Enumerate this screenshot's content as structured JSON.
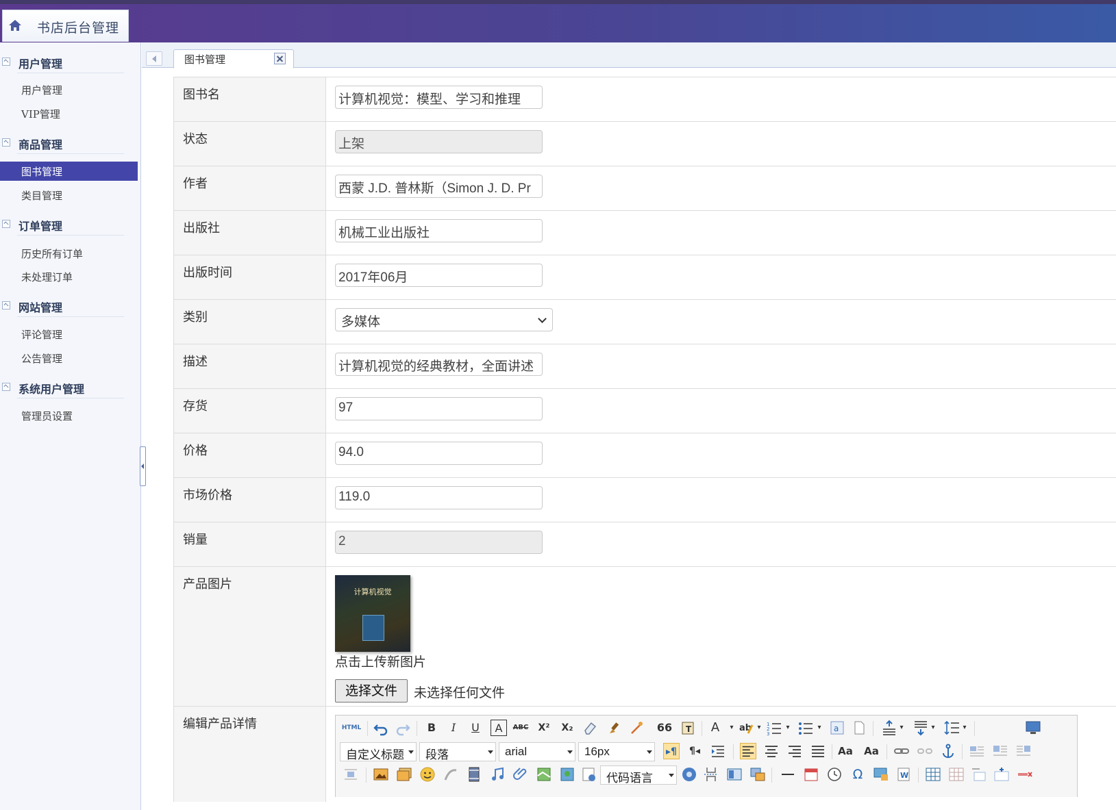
{
  "app": {
    "title": "书店后台管理"
  },
  "sidebar": {
    "groups": [
      {
        "label": "用户管理",
        "items": [
          "用户管理",
          "VIP管理"
        ]
      },
      {
        "label": "商品管理",
        "items": [
          "图书管理",
          "类目管理"
        ]
      },
      {
        "label": "订单管理",
        "items": [
          "历史所有订单",
          "未处理订单"
        ]
      },
      {
        "label": "网站管理",
        "items": [
          "评论管理",
          "公告管理"
        ]
      },
      {
        "label": "系统用户管理",
        "items": [
          "管理员设置"
        ]
      }
    ],
    "active_item": "图书管理"
  },
  "tabs": [
    {
      "label": "图书管理",
      "active": true
    }
  ],
  "form": {
    "name": {
      "label": "图书名",
      "value": "计算机视觉：模型、学习和推理"
    },
    "status": {
      "label": "状态",
      "value": "上架"
    },
    "author": {
      "label": "作者",
      "value": "西蒙 J.D. 普林斯（Simon J. D. Pr"
    },
    "publisher": {
      "label": "出版社",
      "value": "机械工业出版社"
    },
    "pub_date": {
      "label": "出版时间",
      "value": "2017年06月"
    },
    "category": {
      "label": "类别",
      "value": "多媒体"
    },
    "description": {
      "label": "描述",
      "value": "计算机视觉的经典教材，全面讲述"
    },
    "stock": {
      "label": "存货",
      "value": "97"
    },
    "price": {
      "label": "价格",
      "value": "94.0"
    },
    "market_price": {
      "label": "市场价格",
      "value": "119.0"
    },
    "sales": {
      "label": "销量",
      "value": "2"
    },
    "image": {
      "label": "产品图片",
      "cover_text": "计算机视觉",
      "upload_hint": "点击上传新图片",
      "file_button": "选择文件",
      "file_status": "未选择任何文件"
    },
    "details": {
      "label": "编辑产品详情"
    }
  },
  "editor": {
    "combos": {
      "heading": "自定义标题",
      "paragraph": "段落",
      "font": "arial",
      "size": "16px",
      "code_lang": "代码语言"
    },
    "icons": {
      "html": "HTML",
      "bold": "B",
      "italic": "I",
      "underline": "U",
      "fontborder": "A",
      "strike": "ABC",
      "superscript": "X²",
      "subscript": "X₂",
      "quote": "66",
      "forecolor": "A",
      "omega": "Ω"
    }
  }
}
